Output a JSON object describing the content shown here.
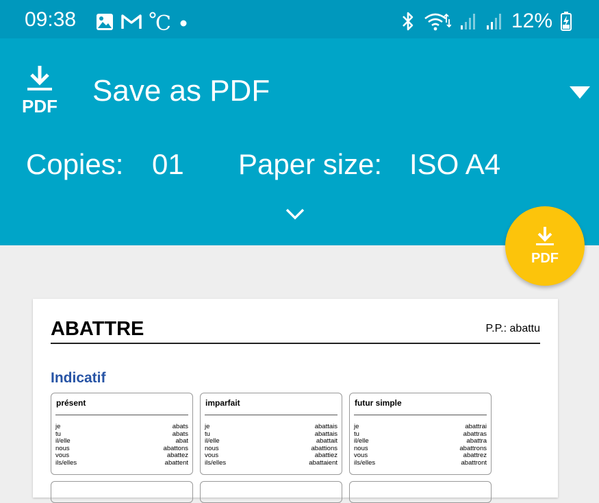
{
  "status_bar": {
    "time": "09:38",
    "battery": "12%",
    "left_icons": [
      "image-icon",
      "gmail-icon",
      "celsius-icon",
      "dot-icon"
    ],
    "right_icons": [
      "bluetooth-icon",
      "wifi-icon",
      "signal-icon",
      "signal-icon",
      "battery-charging-icon"
    ]
  },
  "print_header": {
    "printer_name": "Save as PDF",
    "pdf_icon_label": "PDF",
    "copies_label": "Copies:",
    "copies_value": "01",
    "paper_size_label": "Paper size:",
    "paper_size_value": "ISO A4"
  },
  "fab": {
    "label": "PDF"
  },
  "colors": {
    "header": "#00a5c8",
    "status_bar": "#0098bd",
    "fab": "#fcc40b",
    "mood": "#2754a5"
  },
  "document": {
    "verb": "ABATTRE",
    "past_participle": "P.P.: abattu",
    "mood": "Indicatif",
    "tenses": [
      {
        "name": "présent",
        "rows": [
          [
            "je",
            "abats"
          ],
          [
            "tu",
            "abats"
          ],
          [
            "il/elle",
            "abat"
          ],
          [
            "nous",
            "abattons"
          ],
          [
            "vous",
            "abattez"
          ],
          [
            "ils/elles",
            "abattent"
          ]
        ]
      },
      {
        "name": "imparfait",
        "rows": [
          [
            "je",
            "abattais"
          ],
          [
            "tu",
            "abattais"
          ],
          [
            "il/elle",
            "abattait"
          ],
          [
            "nous",
            "abattions"
          ],
          [
            "vous",
            "abattiez"
          ],
          [
            "ils/elles",
            "abattaient"
          ]
        ]
      },
      {
        "name": "futur simple",
        "rows": [
          [
            "je",
            "abattrai"
          ],
          [
            "tu",
            "abattras"
          ],
          [
            "il/elle",
            "abattra"
          ],
          [
            "nous",
            "abattrons"
          ],
          [
            "vous",
            "abattrez"
          ],
          [
            "ils/elles",
            "abattront"
          ]
        ]
      }
    ]
  }
}
